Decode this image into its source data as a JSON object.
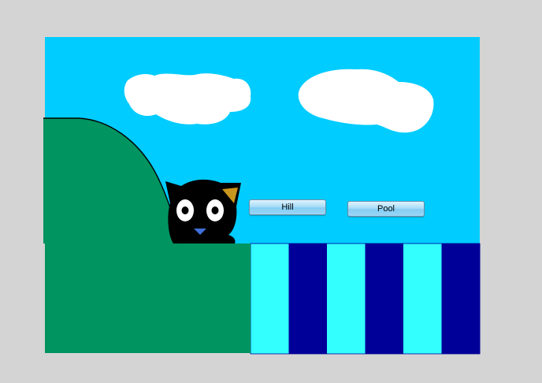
{
  "scene": {
    "colors": {
      "background": "#d4d4d4",
      "sky": "#00ccff",
      "cloud": "#ffffff",
      "hill": "#009460",
      "hill_outline": "#000000",
      "pool_light": "#33ffff",
      "pool_dark": "#000099",
      "cat_body": "#000000",
      "cat_eye_white": "#ffffff",
      "cat_ear_inner": "#c8961e",
      "cat_nose": "#3f6fd8"
    },
    "pool_stripes": 6
  },
  "buttons": {
    "hill_label": "Hill",
    "pool_label": "Pool"
  }
}
